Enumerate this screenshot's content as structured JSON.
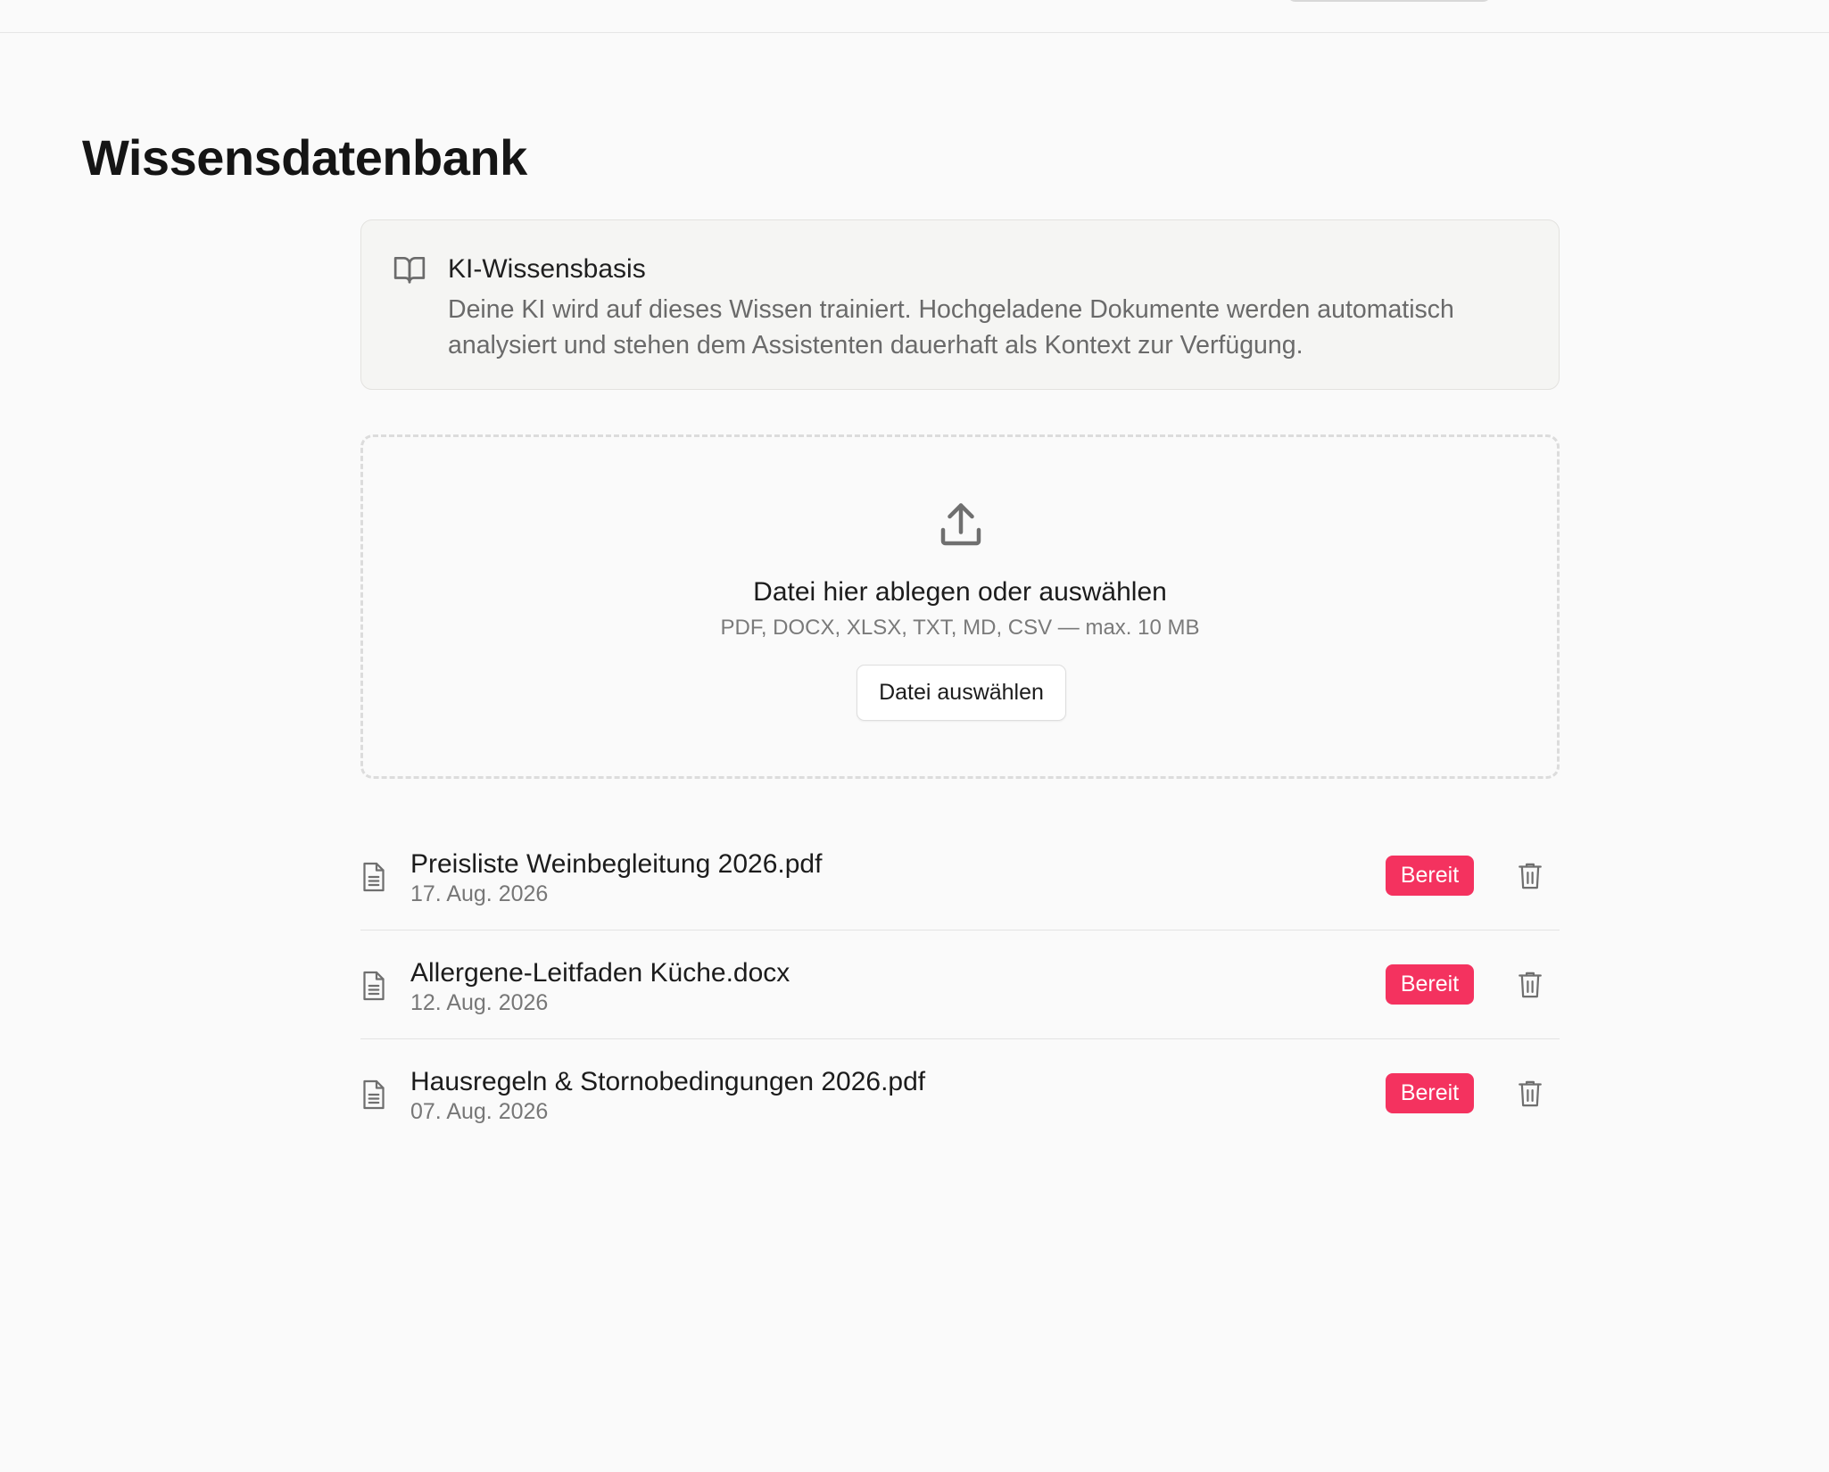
{
  "page": {
    "title": "Wissensdatenbank"
  },
  "info_card": {
    "icon": "book-open-icon",
    "title": "KI-Wissensbasis",
    "description": "Deine KI wird auf dieses Wissen trainiert. Hochgeladene Dokumente werden automatisch analysiert und stehen dem Assistenten dauerhaft als Kontext zur Verfügung."
  },
  "dropzone": {
    "icon": "upload-icon",
    "title": "Datei hier ablegen oder auswählen",
    "formats": "PDF, DOCX, XLSX, TXT, MD, CSV — max. 10 MB",
    "button_label": "Datei auswählen"
  },
  "files": [
    {
      "name": "Preisliste Weinbegleitung 2026.pdf",
      "date": "17. Aug. 2026",
      "status": "Bereit"
    },
    {
      "name": "Allergene-Leitfaden Küche.docx",
      "date": "12. Aug. 2026",
      "status": "Bereit"
    },
    {
      "name": "Hausregeln & Stornobedingungen 2026.pdf",
      "date": "07. Aug. 2026",
      "status": "Bereit"
    }
  ],
  "colors": {
    "accent": "#f4325f",
    "background": "#fafafa",
    "card_background": "#f5f5f3"
  }
}
